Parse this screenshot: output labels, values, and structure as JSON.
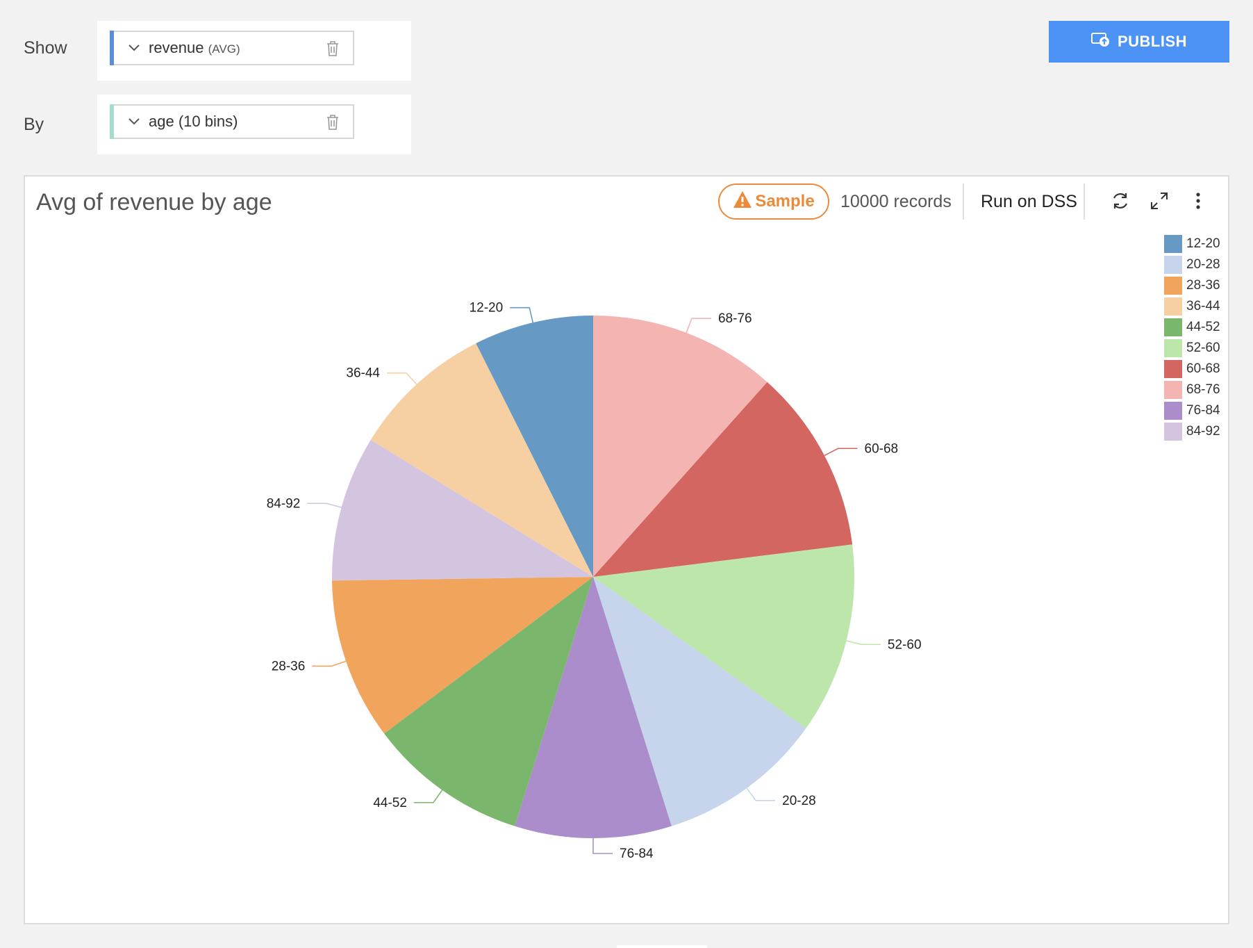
{
  "controls": {
    "show_label": "Show",
    "by_label": "By",
    "show_field": {
      "name": "revenue",
      "agg": "(AVG)",
      "accent": "#5b8ed6"
    },
    "by_field": {
      "name": "age (10 bins)",
      "accent": "#a6dccf"
    }
  },
  "publish": {
    "label": "PUBLISH"
  },
  "toolbar": {
    "sample_label": "Sample",
    "records": "10000 records",
    "run_label": "Run on DSS"
  },
  "icons": {
    "chevron": "chevron-down-icon",
    "trash": "trash-icon",
    "publish": "publish-icon",
    "warning": "warning-icon",
    "refresh": "refresh-icon",
    "expand": "expand-icon",
    "more": "more-vertical-icon"
  },
  "chart_data": {
    "type": "pie",
    "title": "Avg of revenue by age",
    "legend_position": "top-right",
    "slices": [
      {
        "label": "68-76",
        "value": 11.6,
        "color": "#f4b4b2"
      },
      {
        "label": "60-68",
        "value": 11.4,
        "color": "#d46661"
      },
      {
        "label": "52-60",
        "value": 11.8,
        "color": "#bde6ab"
      },
      {
        "label": "20-28",
        "value": 10.3,
        "color": "#c6d5ec"
      },
      {
        "label": "76-84",
        "value": 9.7,
        "color": "#aa8dca"
      },
      {
        "label": "44-52",
        "value": 9.9,
        "color": "#7ab66b"
      },
      {
        "label": "28-36",
        "value": 10.0,
        "color": "#f1a45b"
      },
      {
        "label": "84-92",
        "value": 9.0,
        "color": "#d3c5e0"
      },
      {
        "label": "36-44",
        "value": 8.8,
        "color": "#f6cfa3"
      },
      {
        "label": "12-20",
        "value": 7.4,
        "color": "#6699c4"
      }
    ],
    "legend": [
      {
        "label": "12-20",
        "color": "#6699c4"
      },
      {
        "label": "20-28",
        "color": "#c6d5ec"
      },
      {
        "label": "28-36",
        "color": "#f1a45b"
      },
      {
        "label": "36-44",
        "color": "#f6cfa3"
      },
      {
        "label": "44-52",
        "color": "#7ab66b"
      },
      {
        "label": "52-60",
        "color": "#bde6ab"
      },
      {
        "label": "60-68",
        "color": "#d46661"
      },
      {
        "label": "68-76",
        "color": "#f4b4b2"
      },
      {
        "label": "76-84",
        "color": "#aa8dca"
      },
      {
        "label": "84-92",
        "color": "#d3c5e0"
      }
    ]
  }
}
